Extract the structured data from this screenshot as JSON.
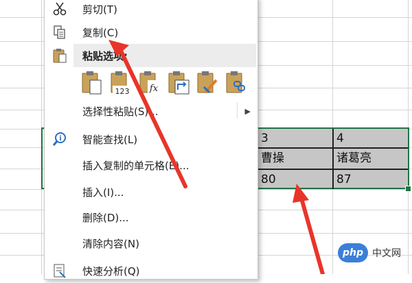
{
  "menu": {
    "cut": "剪切(T)",
    "copy": "复制(C)",
    "paste_options": "粘贴选项:",
    "paste_buttons": [
      "paste-icon",
      "paste-values-icon",
      "paste-formulas-icon",
      "paste-transpose-icon",
      "paste-formatting-icon",
      "paste-link-icon"
    ],
    "paste_values_badge": "123",
    "paste_formulas_badge": "fx",
    "paste_special": "选择性粘贴(S)...",
    "smart_lookup": "智能查找(L)",
    "insert_copied_cells": "插入复制的单元格(E)...",
    "insert": "插入(I)...",
    "delete": "删除(D)...",
    "clear_contents": "清除内容(N)",
    "quick_analysis": "快速分析(Q)"
  },
  "cells": {
    "row1": [
      "3",
      "4"
    ],
    "row2": [
      "曹操",
      "诸葛亮"
    ],
    "row3": [
      "80",
      "87"
    ]
  },
  "colors": {
    "selection_border": "#217346",
    "arrow": "#e8352a",
    "watermark_blue": "#3b7fd8"
  },
  "watermark": {
    "logo": "php",
    "text": "中文网"
  }
}
